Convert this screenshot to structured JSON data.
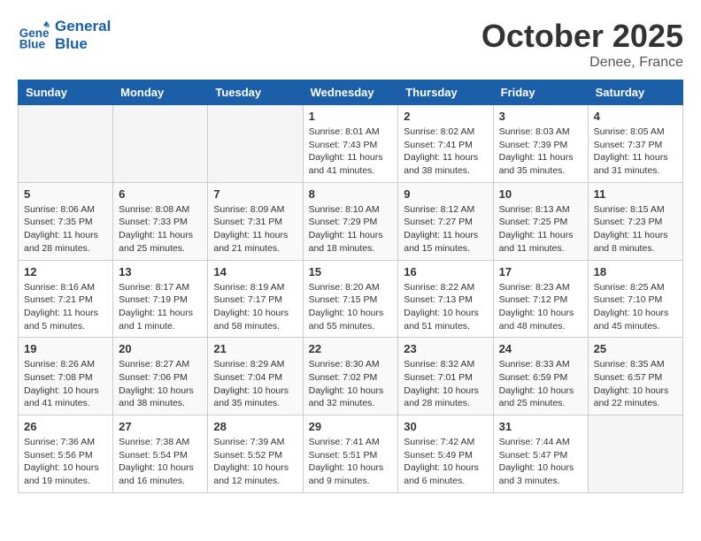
{
  "header": {
    "logo_line1": "General",
    "logo_line2": "Blue",
    "month": "October 2025",
    "location": "Denee, France"
  },
  "weekdays": [
    "Sunday",
    "Monday",
    "Tuesday",
    "Wednesday",
    "Thursday",
    "Friday",
    "Saturday"
  ],
  "weeks": [
    [
      {
        "day": "",
        "sunrise": "",
        "sunset": "",
        "daylight": ""
      },
      {
        "day": "",
        "sunrise": "",
        "sunset": "",
        "daylight": ""
      },
      {
        "day": "",
        "sunrise": "",
        "sunset": "",
        "daylight": ""
      },
      {
        "day": "1",
        "sunrise": "Sunrise: 8:01 AM",
        "sunset": "Sunset: 7:43 PM",
        "daylight": "Daylight: 11 hours and 41 minutes."
      },
      {
        "day": "2",
        "sunrise": "Sunrise: 8:02 AM",
        "sunset": "Sunset: 7:41 PM",
        "daylight": "Daylight: 11 hours and 38 minutes."
      },
      {
        "day": "3",
        "sunrise": "Sunrise: 8:03 AM",
        "sunset": "Sunset: 7:39 PM",
        "daylight": "Daylight: 11 hours and 35 minutes."
      },
      {
        "day": "4",
        "sunrise": "Sunrise: 8:05 AM",
        "sunset": "Sunset: 7:37 PM",
        "daylight": "Daylight: 11 hours and 31 minutes."
      }
    ],
    [
      {
        "day": "5",
        "sunrise": "Sunrise: 8:06 AM",
        "sunset": "Sunset: 7:35 PM",
        "daylight": "Daylight: 11 hours and 28 minutes."
      },
      {
        "day": "6",
        "sunrise": "Sunrise: 8:08 AM",
        "sunset": "Sunset: 7:33 PM",
        "daylight": "Daylight: 11 hours and 25 minutes."
      },
      {
        "day": "7",
        "sunrise": "Sunrise: 8:09 AM",
        "sunset": "Sunset: 7:31 PM",
        "daylight": "Daylight: 11 hours and 21 minutes."
      },
      {
        "day": "8",
        "sunrise": "Sunrise: 8:10 AM",
        "sunset": "Sunset: 7:29 PM",
        "daylight": "Daylight: 11 hours and 18 minutes."
      },
      {
        "day": "9",
        "sunrise": "Sunrise: 8:12 AM",
        "sunset": "Sunset: 7:27 PM",
        "daylight": "Daylight: 11 hours and 15 minutes."
      },
      {
        "day": "10",
        "sunrise": "Sunrise: 8:13 AM",
        "sunset": "Sunset: 7:25 PM",
        "daylight": "Daylight: 11 hours and 11 minutes."
      },
      {
        "day": "11",
        "sunrise": "Sunrise: 8:15 AM",
        "sunset": "Sunset: 7:23 PM",
        "daylight": "Daylight: 11 hours and 8 minutes."
      }
    ],
    [
      {
        "day": "12",
        "sunrise": "Sunrise: 8:16 AM",
        "sunset": "Sunset: 7:21 PM",
        "daylight": "Daylight: 11 hours and 5 minutes."
      },
      {
        "day": "13",
        "sunrise": "Sunrise: 8:17 AM",
        "sunset": "Sunset: 7:19 PM",
        "daylight": "Daylight: 11 hours and 1 minute."
      },
      {
        "day": "14",
        "sunrise": "Sunrise: 8:19 AM",
        "sunset": "Sunset: 7:17 PM",
        "daylight": "Daylight: 10 hours and 58 minutes."
      },
      {
        "day": "15",
        "sunrise": "Sunrise: 8:20 AM",
        "sunset": "Sunset: 7:15 PM",
        "daylight": "Daylight: 10 hours and 55 minutes."
      },
      {
        "day": "16",
        "sunrise": "Sunrise: 8:22 AM",
        "sunset": "Sunset: 7:13 PM",
        "daylight": "Daylight: 10 hours and 51 minutes."
      },
      {
        "day": "17",
        "sunrise": "Sunrise: 8:23 AM",
        "sunset": "Sunset: 7:12 PM",
        "daylight": "Daylight: 10 hours and 48 minutes."
      },
      {
        "day": "18",
        "sunrise": "Sunrise: 8:25 AM",
        "sunset": "Sunset: 7:10 PM",
        "daylight": "Daylight: 10 hours and 45 minutes."
      }
    ],
    [
      {
        "day": "19",
        "sunrise": "Sunrise: 8:26 AM",
        "sunset": "Sunset: 7:08 PM",
        "daylight": "Daylight: 10 hours and 41 minutes."
      },
      {
        "day": "20",
        "sunrise": "Sunrise: 8:27 AM",
        "sunset": "Sunset: 7:06 PM",
        "daylight": "Daylight: 10 hours and 38 minutes."
      },
      {
        "day": "21",
        "sunrise": "Sunrise: 8:29 AM",
        "sunset": "Sunset: 7:04 PM",
        "daylight": "Daylight: 10 hours and 35 minutes."
      },
      {
        "day": "22",
        "sunrise": "Sunrise: 8:30 AM",
        "sunset": "Sunset: 7:02 PM",
        "daylight": "Daylight: 10 hours and 32 minutes."
      },
      {
        "day": "23",
        "sunrise": "Sunrise: 8:32 AM",
        "sunset": "Sunset: 7:01 PM",
        "daylight": "Daylight: 10 hours and 28 minutes."
      },
      {
        "day": "24",
        "sunrise": "Sunrise: 8:33 AM",
        "sunset": "Sunset: 6:59 PM",
        "daylight": "Daylight: 10 hours and 25 minutes."
      },
      {
        "day": "25",
        "sunrise": "Sunrise: 8:35 AM",
        "sunset": "Sunset: 6:57 PM",
        "daylight": "Daylight: 10 hours and 22 minutes."
      }
    ],
    [
      {
        "day": "26",
        "sunrise": "Sunrise: 7:36 AM",
        "sunset": "Sunset: 5:56 PM",
        "daylight": "Daylight: 10 hours and 19 minutes."
      },
      {
        "day": "27",
        "sunrise": "Sunrise: 7:38 AM",
        "sunset": "Sunset: 5:54 PM",
        "daylight": "Daylight: 10 hours and 16 minutes."
      },
      {
        "day": "28",
        "sunrise": "Sunrise: 7:39 AM",
        "sunset": "Sunset: 5:52 PM",
        "daylight": "Daylight: 10 hours and 12 minutes."
      },
      {
        "day": "29",
        "sunrise": "Sunrise: 7:41 AM",
        "sunset": "Sunset: 5:51 PM",
        "daylight": "Daylight: 10 hours and 9 minutes."
      },
      {
        "day": "30",
        "sunrise": "Sunrise: 7:42 AM",
        "sunset": "Sunset: 5:49 PM",
        "daylight": "Daylight: 10 hours and 6 minutes."
      },
      {
        "day": "31",
        "sunrise": "Sunrise: 7:44 AM",
        "sunset": "Sunset: 5:47 PM",
        "daylight": "Daylight: 10 hours and 3 minutes."
      },
      {
        "day": "",
        "sunrise": "",
        "sunset": "",
        "daylight": ""
      }
    ]
  ]
}
